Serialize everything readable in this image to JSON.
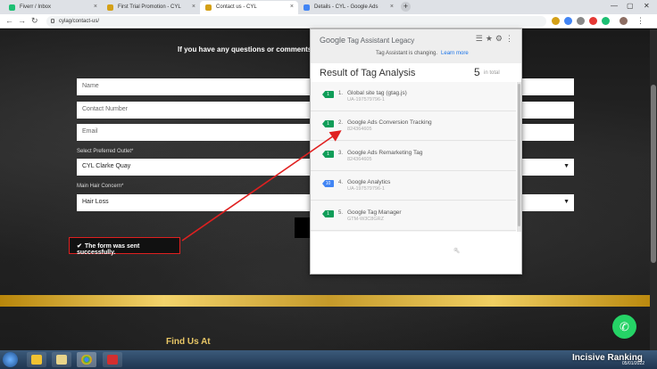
{
  "browser": {
    "tabs": [
      {
        "label": "Fiverr / Inbox",
        "color": "#1dbf73",
        "active": false
      },
      {
        "label": "First Trial Promotion - CYL",
        "color": "#d4a017",
        "active": false
      },
      {
        "label": "Contact us - CYL",
        "color": "#d4a017",
        "active": true
      },
      {
        "label": "Details - CYL - Google Ads",
        "color": "#4285f4",
        "active": false
      }
    ],
    "new_tab": "+",
    "url": "cylag/contact-us/"
  },
  "page": {
    "intro": "If you have any questions or comments fo",
    "fields": {
      "name": "Name",
      "contact": "Contact Number",
      "email": "Email",
      "outlet_label": "Select Preferred Outlet*",
      "outlet_value": "CYL Clarke Quay",
      "concern_label": "Main Hair Concern*",
      "concern_value": "Hair Loss"
    },
    "success_message": "The form was sent successfully.",
    "find_us": "Find Us At"
  },
  "tag_assistant": {
    "logo_google": "Google",
    "logo_rest": " Tag Assistant Legacy",
    "notice": "Tag Assistant is changing.",
    "learn_more": "Learn more",
    "result_title": "Result of Tag Analysis",
    "count": "5",
    "count_label": "in total",
    "tags": [
      {
        "num": "1.",
        "name": "Global site tag (gtag.js)",
        "id": "UA-197579796-1",
        "badge": "1",
        "color": "#0f9d58"
      },
      {
        "num": "2.",
        "name": "Google Ads Conversion Tracking",
        "id": "824364605",
        "badge": "1",
        "color": "#0f9d58"
      },
      {
        "num": "3.",
        "name": "Google Ads Remarketing Tag",
        "id": "824364605",
        "badge": "1",
        "color": "#0f9d58"
      },
      {
        "num": "4.",
        "name": "Google Analytics",
        "id": "UA-197579796-1",
        "badge": "10",
        "color": "#4285f4"
      },
      {
        "num": "5.",
        "name": "Google Tag Manager",
        "id": "GTM-W3C8GRZ",
        "badge": "1",
        "color": "#0f9d58"
      }
    ]
  },
  "taskbar": {
    "brand": "Incisive Ranking",
    "date": "05/01/2022"
  }
}
